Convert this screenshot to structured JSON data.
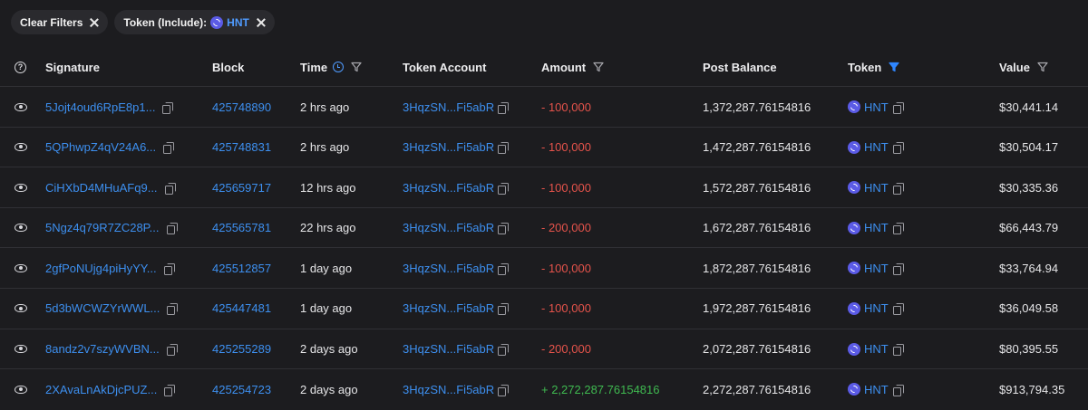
{
  "filters": {
    "clear_label": "Clear Filters",
    "token_filter_label": "Token (Include):",
    "token_filter_value": "HNT"
  },
  "columns": {
    "signature": "Signature",
    "block": "Block",
    "time": "Time",
    "token_account": "Token Account",
    "amount": "Amount",
    "post_balance": "Post Balance",
    "token": "Token",
    "value": "Value"
  },
  "colors": {
    "link": "#3d8fef",
    "negative": "#e5534b",
    "positive": "#3fb950",
    "token_logo": "#5b5be6",
    "active_filter": "#4f9bff"
  },
  "rows": [
    {
      "signature": "5Jojt4oud6RpE8p1...",
      "block": "425748890",
      "time": "2 hrs ago",
      "account": "3HqzSN...Fi5abR",
      "amount": "- 100,000",
      "amount_sign": "neg",
      "post_balance": "1,372,287.76154816",
      "token": "HNT",
      "value": "$30,441.14"
    },
    {
      "signature": "5QPhwpZ4qV24A6...",
      "block": "425748831",
      "time": "2 hrs ago",
      "account": "3HqzSN...Fi5abR",
      "amount": "- 100,000",
      "amount_sign": "neg",
      "post_balance": "1,472,287.76154816",
      "token": "HNT",
      "value": "$30,504.17"
    },
    {
      "signature": "CiHXbD4MHuAFq9...",
      "block": "425659717",
      "time": "12 hrs ago",
      "account": "3HqzSN...Fi5abR",
      "amount": "- 100,000",
      "amount_sign": "neg",
      "post_balance": "1,572,287.76154816",
      "token": "HNT",
      "value": "$30,335.36"
    },
    {
      "signature": "5Ngz4q79R7ZC28P...",
      "block": "425565781",
      "time": "22 hrs ago",
      "account": "3HqzSN...Fi5abR",
      "amount": "- 200,000",
      "amount_sign": "neg",
      "post_balance": "1,672,287.76154816",
      "token": "HNT",
      "value": "$66,443.79"
    },
    {
      "signature": "2gfPoNUjg4piHyYY...",
      "block": "425512857",
      "time": "1 day ago",
      "account": "3HqzSN...Fi5abR",
      "amount": "- 100,000",
      "amount_sign": "neg",
      "post_balance": "1,872,287.76154816",
      "token": "HNT",
      "value": "$33,764.94"
    },
    {
      "signature": "5d3bWCWZYrWWL...",
      "block": "425447481",
      "time": "1 day ago",
      "account": "3HqzSN...Fi5abR",
      "amount": "- 100,000",
      "amount_sign": "neg",
      "post_balance": "1,972,287.76154816",
      "token": "HNT",
      "value": "$36,049.58"
    },
    {
      "signature": "8andz2v7szyWVBN...",
      "block": "425255289",
      "time": "2 days ago",
      "account": "3HqzSN...Fi5abR",
      "amount": "- 200,000",
      "amount_sign": "neg",
      "post_balance": "2,072,287.76154816",
      "token": "HNT",
      "value": "$80,395.55"
    },
    {
      "signature": "2XAvaLnAkDjcPUZ...",
      "block": "425254723",
      "time": "2 days ago",
      "account": "3HqzSN...Fi5abR",
      "amount": "+ 2,272,287.76154816",
      "amount_sign": "pos",
      "post_balance": "2,272,287.76154816",
      "token": "HNT",
      "value": "$913,794.35"
    }
  ]
}
